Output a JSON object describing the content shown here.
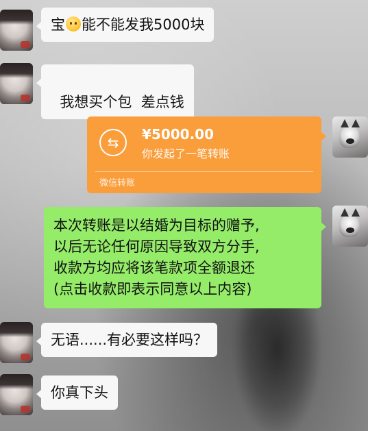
{
  "messages": [
    {
      "parts": [
        "宝",
        "能不能发我5000块"
      ],
      "emoji": "smiling-face-with-tear"
    },
    {
      "text": "我想买个包  差点钱"
    },
    {
      "transfer": {
        "amount": "¥5000.00",
        "desc": "你发起了一笔转账",
        "source": "微信转账"
      }
    },
    {
      "lines": [
        "本次转账是以结婚为目标的赠予,",
        "以后无论任何原因导致双方分手,",
        "收款方均应将该笔款项全额退还",
        "(点击收款即表示同意以上内容)"
      ]
    },
    {
      "text": "无语......有必要这样吗？"
    },
    {
      "text": "你真下头"
    }
  ],
  "colors": {
    "sent_bubble": "#95ec69",
    "received_bubble": "#f7f7f7",
    "transfer_card": "#fa9d3b"
  },
  "icons": {
    "transfer_icon": "exchange-arrows-icon",
    "transfer_glyph": "⇆"
  }
}
